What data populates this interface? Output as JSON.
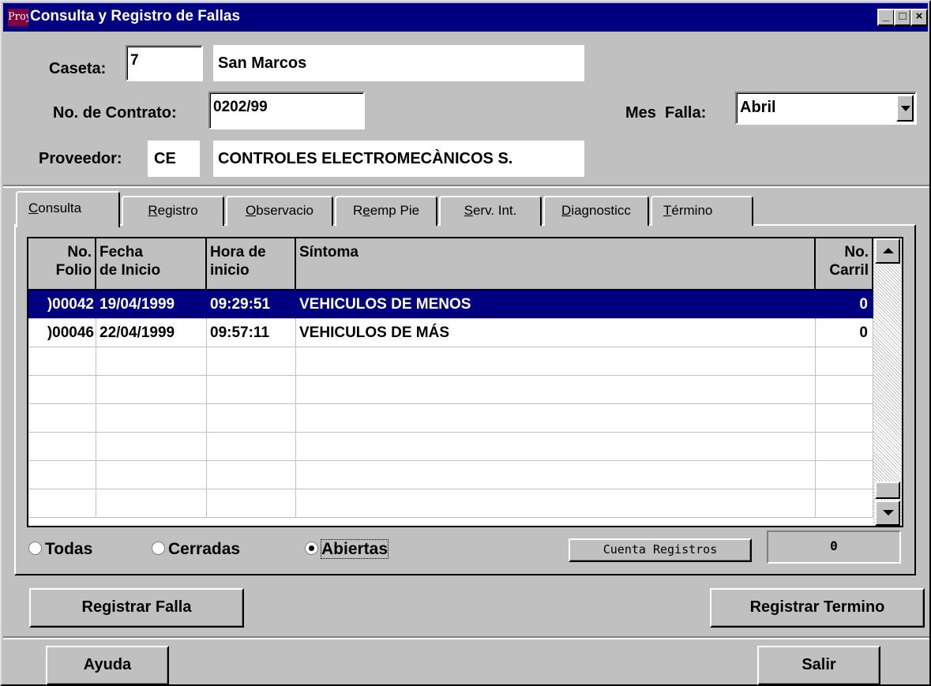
{
  "window": {
    "title": "Consulta y Registro de Fallas",
    "icon_text": "Proy",
    "controls": {
      "minimize": "_",
      "maximize": "□",
      "close": "×"
    }
  },
  "form": {
    "caseta_label": "Caseta:",
    "caseta_value": "7",
    "caseta_name": "San Marcos",
    "contrato_label": "No. de Contrato:",
    "contrato_value": "0202/99",
    "mes_falla_label": "Mes  Falla:",
    "mes_falla_value": "Abril",
    "proveedor_label": "Proveedor:",
    "proveedor_code": "CE",
    "proveedor_name": "CONTROLES ELECTROMECÀNICOS S."
  },
  "tabs": [
    {
      "label": "Consulta",
      "u": "C",
      "rest": "onsulta"
    },
    {
      "label": "Registro",
      "u": "R",
      "rest": "egistro"
    },
    {
      "label": "Observacio",
      "u": "O",
      "rest": "bservacio"
    },
    {
      "label": "Reemp Pie",
      "pre": "R",
      "u": "e",
      "rest": "emp Pie"
    },
    {
      "label": "Serv. Int.",
      "u": "S",
      "rest": "erv. Int."
    },
    {
      "label": "Diagnosticc",
      "u": "D",
      "rest": "iagnosticc"
    },
    {
      "label": "Término",
      "u": "T",
      "rest": "érmino"
    }
  ],
  "grid": {
    "headers": {
      "folio": [
        "No.",
        "Folio"
      ],
      "fecha": [
        "Fecha",
        "de Inicio"
      ],
      "hora": [
        "Hora de",
        "inicio"
      ],
      "sintoma": [
        "",
        "Síntoma"
      ],
      "carril": [
        "No.",
        "Carril"
      ]
    },
    "rows": [
      {
        "folio": ")00042",
        "fecha": "19/04/1999",
        "hora": "09:29:51",
        "sintoma": "VEHICULOS DE MENOS",
        "carril": "0",
        "selected": true
      },
      {
        "folio": ")00046",
        "fecha": "22/04/1999",
        "hora": "09:57:11",
        "sintoma": "VEHICULOS DE MÁS",
        "carril": "0",
        "selected": false
      }
    ]
  },
  "filters": {
    "todas": "Todas",
    "cerradas": "Cerradas",
    "abiertas": "Abiertas",
    "selected": "abiertas"
  },
  "count": {
    "button_label": "Cuenta Registros",
    "value": "0"
  },
  "buttons": {
    "registrar_falla": "Registrar Falla",
    "registrar_termino": "Registrar Termino",
    "ayuda": "Ayuda",
    "salir": "Salir"
  }
}
